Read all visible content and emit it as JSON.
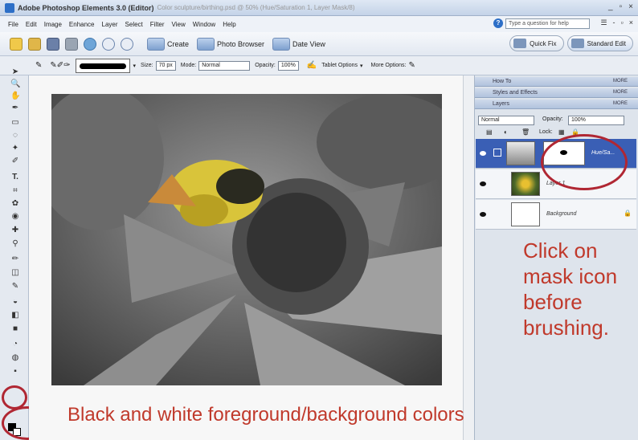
{
  "window": {
    "title": "Adobe Photoshop Elements 3.0 (Editor)",
    "document": "Color sculpture/birthing.psd @ 50% (Hue/Saturation 1, Layer Mask/8)",
    "controls": [
      "_",
      "▫",
      "×"
    ]
  },
  "menu": {
    "items": [
      "File",
      "Edit",
      "Image",
      "Enhance",
      "Layer",
      "Select",
      "Filter",
      "View",
      "Window",
      "Help"
    ],
    "help_placeholder": "Type a question for help",
    "controls": [
      "☰",
      "-",
      "▫",
      "×"
    ]
  },
  "shortcuts": {
    "create": "Create",
    "photo_browser": "Photo Browser",
    "date_view": "Date View",
    "quick_fix": "Quick Fix",
    "standard_edit": "Standard Edit"
  },
  "options_bar": {
    "size_label": "Size:",
    "size_value": "70 px",
    "mode_label": "Mode:",
    "mode_value": "Normal",
    "opacity_label": "Opacity:",
    "opacity_value": "100%",
    "tablet_options": "Tablet Options",
    "more_options": "More Options:"
  },
  "palettes": {
    "how_to": "How To",
    "styles_effects": "Styles and Effects",
    "layers": "Layers",
    "more_label": "MORE",
    "blend_mode": "Normal",
    "opacity_label": "Opacity:",
    "opacity_value": "100%",
    "lock_label": "Lock:"
  },
  "layers": [
    {
      "name": "Hue/Sa...",
      "selected": true
    },
    {
      "name": "Layer 1",
      "selected": false
    },
    {
      "name": "Background",
      "selected": false
    }
  ],
  "annotations": {
    "right": "Click on mask icon before brushing.",
    "bottom": "Black and white foreground/background colors"
  },
  "colors": {
    "annotation": "#c0392b",
    "selection": "#3a5fb5"
  }
}
